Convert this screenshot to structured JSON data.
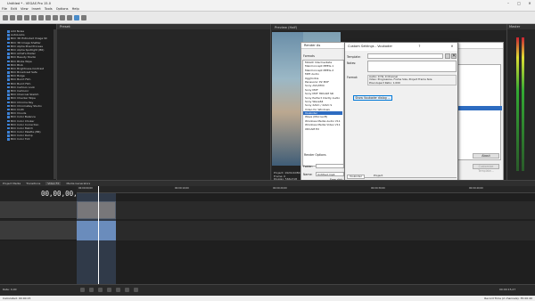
{
  "title_bar": {
    "title": "Untitled * - VEGAS Pro 15.0"
  },
  "menu": [
    "File",
    "Edit",
    "View",
    "Insert",
    "Tools",
    "Options",
    "Help"
  ],
  "fx_tree": [
    "Add Noise",
    "AutoLooks",
    "BCC 3D Extruded Image Sh",
    "BCC 3D Image Shatter",
    "BCC Alpha Pixel Process",
    "BCC Alpha Spotlight (B6)",
    "BCC Artist's Poster",
    "BCC Beauty Studio",
    "BCC Blobs Wipe",
    "BCC Blob",
    "BCC Brightness-Contrast",
    "BCC Broadcast Safe",
    "BCC Bulge",
    "BCC Burnt Film",
    "BCC Burnt Film",
    "BCC Cartoon Look",
    "BCC Cartoonr",
    "BCC Charcoal Sketch",
    "BCC Checker Wipe",
    "BCC Chroma Key",
    "BCC ChromaKey Studio",
    "BCC Cloth",
    "BCC Clouds",
    "BCC Color Balance",
    "BCC Color Choker",
    "BCC Color Correction",
    "BCC Color Match",
    "BCC Color Palette (B6)",
    "BCC Color Ramp",
    "BCC Color Tint"
  ],
  "fx_list": {
    "header": "Preset:"
  },
  "preview": {
    "toolbar": "Preview (Half)",
    "info": [
      "Project: 1920x1080x32",
      "Frame: 0",
      "Display: 566x318"
    ]
  },
  "render_dialog": {
    "title": "Render As",
    "formats_label": "Formats",
    "formats": [
      "MAGIX Intermediate",
      "MainConcept MPEG-1",
      "MainConcept MPEG-2",
      "MP3 Audio",
      "OggVorbis",
      "Panasonic P2 MXF",
      "Sony AVC/MVC",
      "Sony MXF",
      "Sony MXF HDCAM SR",
      "Sony Perfect Clarity Audio",
      "Sony Wave64",
      "Sony XAVC / XAVC S",
      "Video for Windows",
      "Voukoder",
      "Wave (Microsoft)",
      "Windows Media Audio V11",
      "Windows Media Video V11",
      "XDCAM EX"
    ],
    "selected_format": "Voukoder",
    "render_options": "Render Options",
    "folder_label": "Folder:",
    "name_label": "Name:",
    "name_value": "Untitled.mp4",
    "free_label": "Free disk",
    "about_btn": "About",
    "customize_btn": "Customize Template...",
    "render_btn": "Render",
    "cancel_btn": "Cancel"
  },
  "custom_dialog": {
    "title": "Custom Settings - Voukoder",
    "template_label": "Template:",
    "template_value": "",
    "notes_label": "Notes:",
    "format_label": "Format:",
    "format_lines": [
      "Audio: 0 Hz, 0 Channel",
      "Video: Progressive, Frame Size, Project Frame Size",
      "Pixel Aspect Ratio: 1.000"
    ],
    "show_btn": "Show Voukoder dialog ...",
    "tab_voukoder": "Voukoder",
    "tab_project": "Project",
    "ok": "OK",
    "cancel": "Cancel"
  },
  "tabs_bottom": [
    "Project Media",
    "Transitions",
    "Video FX",
    "Media Generators"
  ],
  "mixer": {
    "title": "Master"
  },
  "timeline": {
    "timecode": "00,00,00,00",
    "ruler": [
      "00:00:00;00",
      "00:00:10;00",
      "00:00:20;00",
      "00:00:30;00",
      "00:00:40;00"
    ],
    "rate": "Rate: 0,00",
    "end_time": "00:00:15,27",
    "status_left": "Calculated: 00:00:15",
    "status_right": "Record Time (2 channels): 35:00:40"
  }
}
